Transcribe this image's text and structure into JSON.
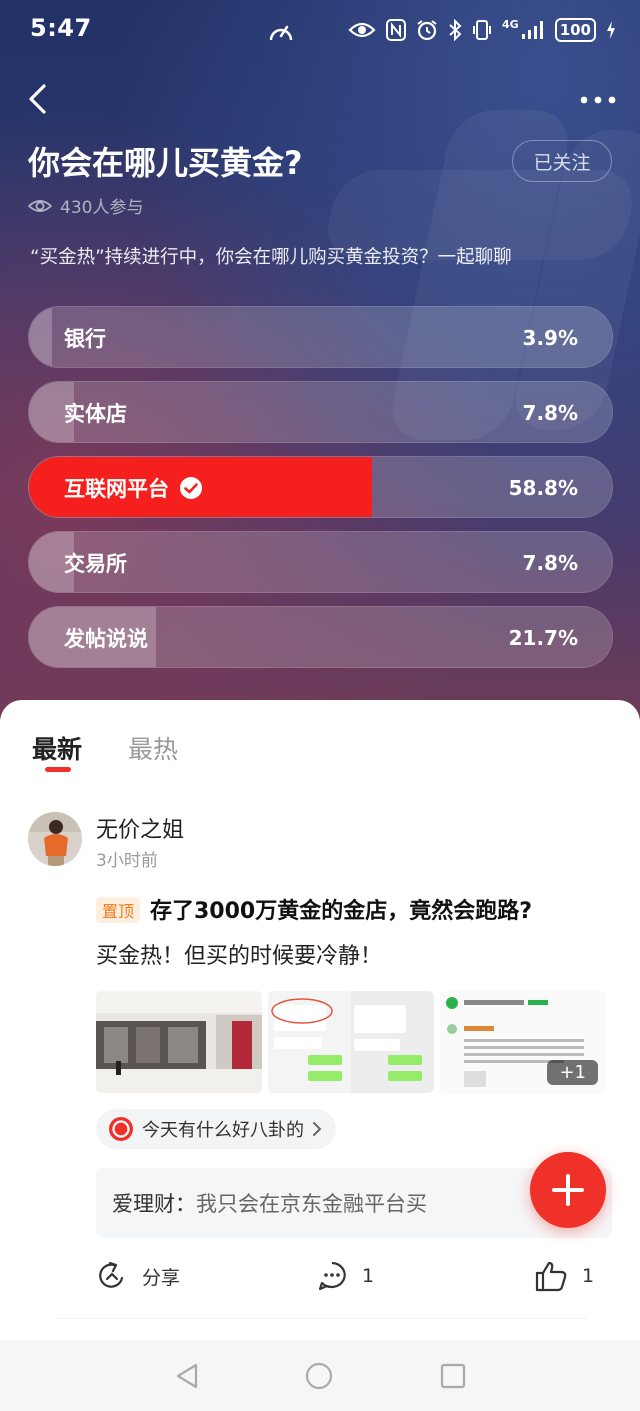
{
  "status_bar": {
    "time": "5:47",
    "network": "4G",
    "battery": "100"
  },
  "header": {
    "title": "你会在哪儿买黄金?",
    "follow_label": "已关注",
    "participants": "430人参与",
    "description": "“买金热”持续进行中，你会在哪儿购买黄金投资？一起聊聊"
  },
  "poll": {
    "options": [
      {
        "label": "银行",
        "percent_text": "3.9%",
        "percent": 3.9,
        "selected": false
      },
      {
        "label": "实体店",
        "percent_text": "7.8%",
        "percent": 7.8,
        "selected": false
      },
      {
        "label": "互联网平台",
        "percent_text": "58.8%",
        "percent": 58.8,
        "selected": true
      },
      {
        "label": "交易所",
        "percent_text": "7.8%",
        "percent": 7.8,
        "selected": false
      },
      {
        "label": "发帖说说",
        "percent_text": "21.7%",
        "percent": 21.7,
        "selected": false
      }
    ],
    "selected_color": "#f5201e"
  },
  "tabs": {
    "latest": "最新",
    "hot": "最热"
  },
  "post": {
    "username": "无价之姐",
    "time_ago": "3小时前",
    "pinned_label": "置顶",
    "title": "存了3000万黄金的金店，竟然会跑路?",
    "body": "买金热！但买的时候要冷静！",
    "more_images": "+1",
    "topic": "今天有什么好八卦的",
    "comment_user": "爱理财：",
    "comment_text": "我只会在京东金融平台买",
    "share_label": "分享",
    "comment_count": "1",
    "like_count": "1"
  },
  "colors": {
    "accent": "#f0312a",
    "pinned": "#f07a1d"
  }
}
